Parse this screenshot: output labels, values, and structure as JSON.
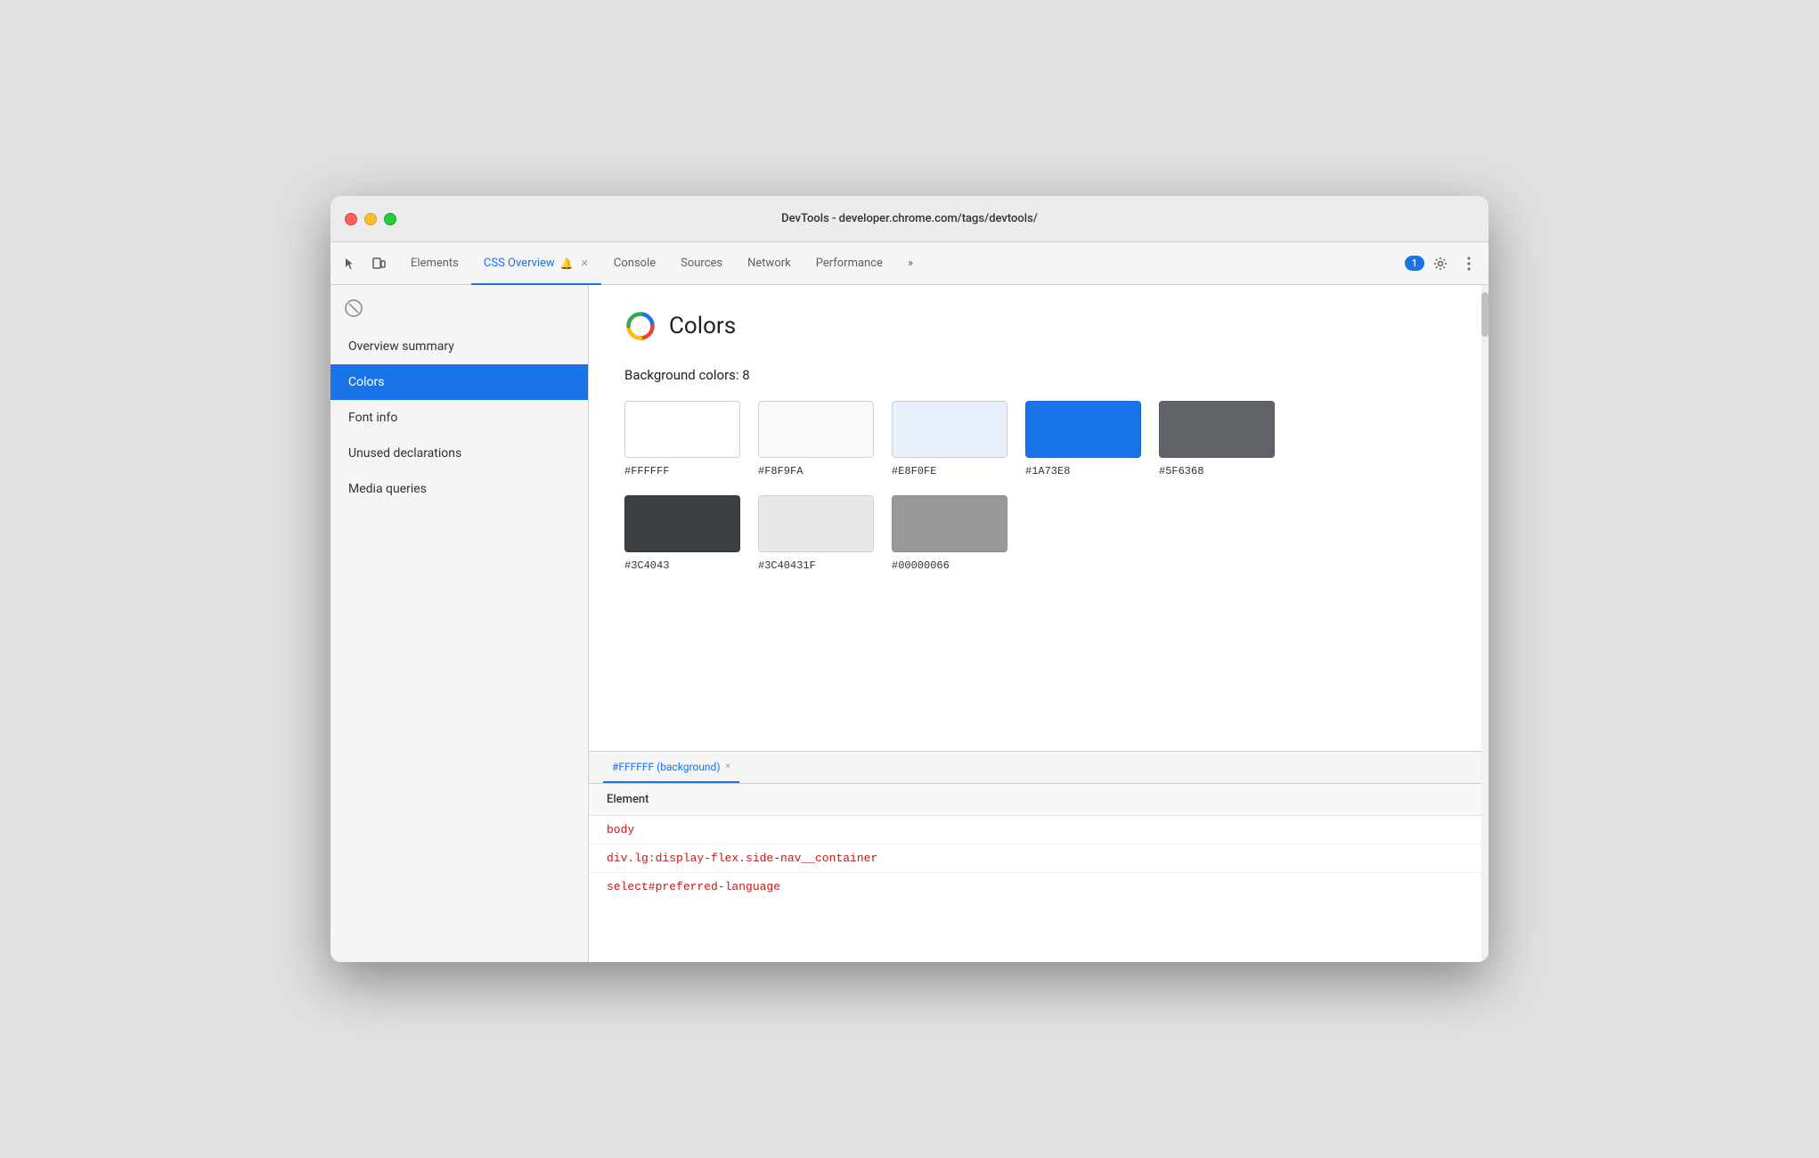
{
  "window": {
    "title": "DevTools - developer.chrome.com/tags/devtools/"
  },
  "tabs": {
    "items": [
      {
        "label": "Elements",
        "active": false,
        "closeable": false
      },
      {
        "label": "CSS Overview",
        "active": true,
        "closeable": true,
        "has_badge": true
      },
      {
        "label": "Console",
        "active": false,
        "closeable": false
      },
      {
        "label": "Sources",
        "active": false,
        "closeable": false
      },
      {
        "label": "Network",
        "active": false,
        "closeable": false
      },
      {
        "label": "Performance",
        "active": false,
        "closeable": false
      }
    ],
    "more_label": "»",
    "notification": "1"
  },
  "sidebar": {
    "items": [
      {
        "label": "Overview summary",
        "active": false
      },
      {
        "label": "Colors",
        "active": true
      },
      {
        "label": "Font info",
        "active": false
      },
      {
        "label": "Unused declarations",
        "active": false
      },
      {
        "label": "Media queries",
        "active": false
      }
    ]
  },
  "colors_panel": {
    "title": "Colors",
    "subtitle": "Background colors: 8",
    "swatches": [
      {
        "hex": "#FFFFFF",
        "display": "#FFFFFF",
        "color": "#FFFFFF",
        "border": true,
        "selected": false
      },
      {
        "hex": "#F8F9FA",
        "display": "#F8F9FA",
        "color": "#F8F9FA",
        "border": true,
        "selected": false
      },
      {
        "hex": "#E8F0FE",
        "display": "#E8F0FE",
        "color": "#E8F0FE",
        "border": true,
        "selected": false
      },
      {
        "hex": "#1A73E8",
        "display": "#1A73E8",
        "color": "#1A73E8",
        "border": false,
        "selected": false
      },
      {
        "hex": "#5F6368",
        "display": "#5F6368",
        "color": "#5F6368",
        "border": false,
        "selected": false
      },
      {
        "hex": "#3C4043",
        "display": "#3C4043",
        "color": "#3C4043",
        "border": false,
        "selected": false
      },
      {
        "hex": "#3C40431F",
        "display": "#3C40431F",
        "color": "rgba(60,64,67,0.12)",
        "border": true,
        "selected": false
      },
      {
        "hex": "#00000066",
        "display": "#00000066",
        "color": "rgba(0,0,0,0.4)",
        "border": false,
        "selected": false
      }
    ]
  },
  "bottom_panel": {
    "tab_label": "#FFFFFF (background)",
    "close_label": "×",
    "element_header": "Element",
    "elements": [
      "body",
      "div.lg:display-flex.side-nav__container",
      "select#preferred-language"
    ]
  }
}
